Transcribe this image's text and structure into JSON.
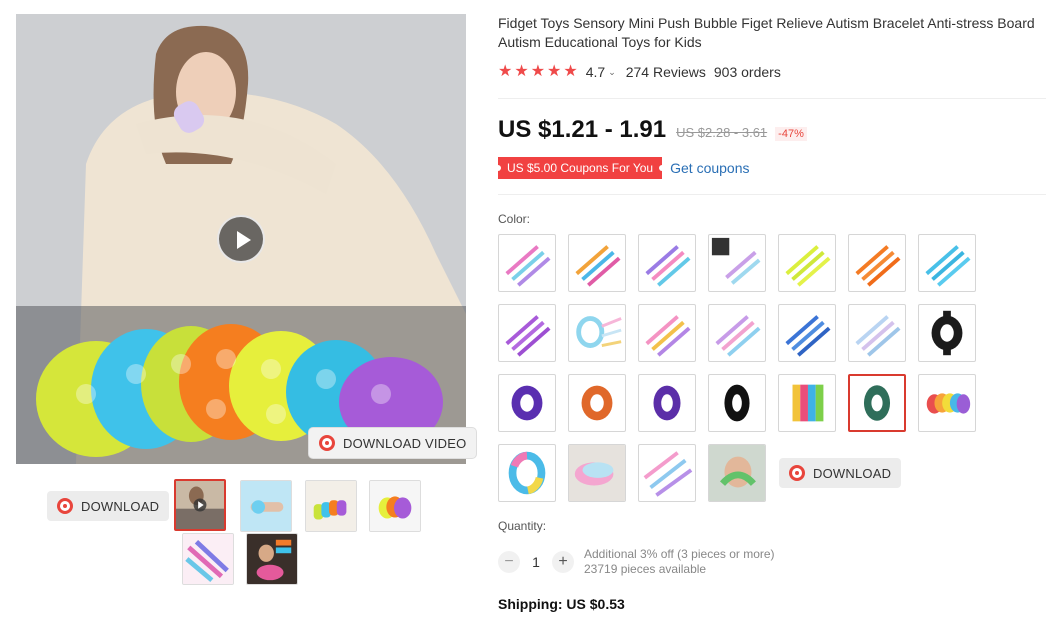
{
  "product": {
    "title": "Fidget Toys Sensory Mini Push Bubble Figet Relieve Autism Bracelet Anti-stress Board Autism Educational Toys for Kids",
    "rating": "4.7",
    "reviews": "274 Reviews",
    "orders": "903 orders",
    "price": "US $1.21 - 1.91",
    "original_price": "US $2.28 - 3.61",
    "discount": "-47%",
    "coupon_badge": "US $5.00 Coupons For You",
    "get_coupons": "Get coupons",
    "color_label": "Color:",
    "quantity_label": "Quantity:",
    "quantity_value": "1",
    "quantity_decrement": "−",
    "quantity_increment": "+",
    "bulk_discount": "Additional 3% off (3 pieces or more)",
    "availability": "23719 pieces available",
    "shipping": "Shipping: US $0.53"
  },
  "media": {
    "download_video_label": "DOWNLOAD VIDEO",
    "download_label": "DOWNLOAD",
    "thumbnail_count": 6
  },
  "swatch_download_label": "DOWNLOAD",
  "colors": {
    "accent_red": "#e8453c",
    "star": "#ef4a4a",
    "link": "#2a6fb5",
    "selected_border": "#d93a2f"
  },
  "icons": [
    "play-icon",
    "download-icon",
    "star-icon",
    "chevron-down-icon",
    "minus-icon",
    "plus-icon"
  ]
}
